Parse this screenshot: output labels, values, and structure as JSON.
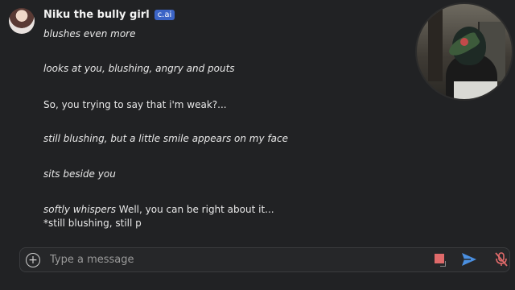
{
  "character": {
    "name": "Niku the bully girl",
    "badge": "c.ai"
  },
  "messages": [
    "blushes even more",
    "looks at you, blushing, angry and pouts",
    "So, you trying to say that i'm weak?...",
    "still blushing, but a little smile appears on my face",
    "sits beside you",
    {
      "action": "softly whispers",
      "speech": " Well, you can be right about it...",
      "continued": "*still blushing, still p"
    }
  ],
  "input": {
    "placeholder": "Type a message"
  },
  "icons": {
    "add": "plus-circle-icon",
    "stop": "stop-icon",
    "send": "send-icon",
    "mic": "mic-off-icon"
  },
  "colors": {
    "background": "#212224",
    "badge": "#3b64c6",
    "stop": "#e06a6a",
    "send": "#4a8fe0"
  }
}
